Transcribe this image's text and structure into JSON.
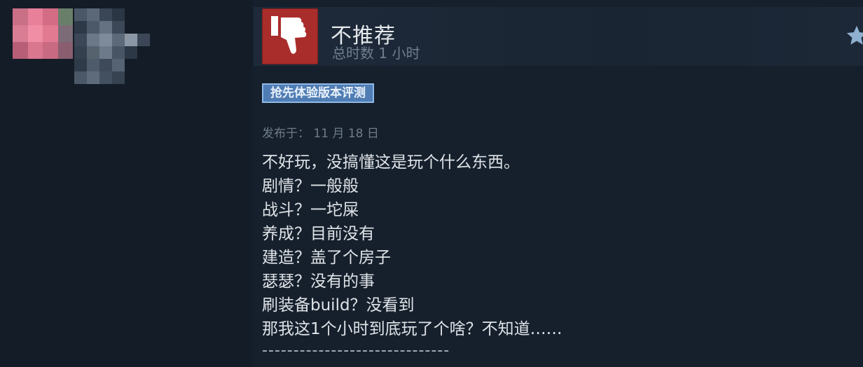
{
  "review": {
    "verdict": "不推荐",
    "hours": "总时数 1 小时",
    "badge": "抢先体验版本评测",
    "posted": "发布于：  11 月 18 日",
    "lines": [
      "不好玩，没搞懂这是玩个什么东西。",
      "剧情？一般般",
      "战斗？一坨屎",
      "养成？目前没有",
      "建造？盖了个房子",
      "瑟瑟？没有的事",
      "刷装备build？没看到",
      "那我这1个小时到底玩了个啥？不知道……"
    ],
    "divider": "------------------------------"
  },
  "colors": {
    "background": "#16202d",
    "thumb_red": "#a92d2b",
    "badge_blue": "#4f7db4",
    "text": "#dfe3e7",
    "muted": "#6f7e8e"
  },
  "icons": {
    "verdict": "thumbs-down-icon",
    "award": "star-icon"
  }
}
